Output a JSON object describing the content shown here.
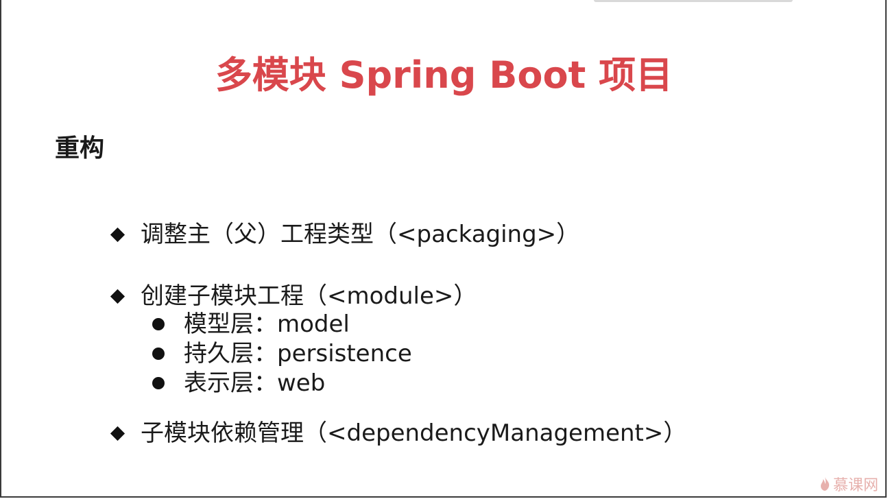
{
  "title": "多模块 Spring Boot 项目",
  "section_heading": "重构",
  "items": [
    {
      "label": "调整主（父）工程类型（<packaging>）"
    },
    {
      "label": "创建子模块工程（<module>）",
      "children": [
        {
          "label": "模型层：model"
        },
        {
          "label": "持久层：persistence"
        },
        {
          "label": "表示层：web"
        }
      ]
    },
    {
      "label": "子模块依赖管理（<dependencyManagement>）"
    }
  ],
  "watermark": "慕课网",
  "colors": {
    "title": "#d9474c",
    "text": "#1a1a1a",
    "watermark": "#e7b1ad"
  },
  "icons": {
    "bullet": "diamond",
    "sub_bullet": "filled-circle",
    "watermark": "flame-icon"
  }
}
